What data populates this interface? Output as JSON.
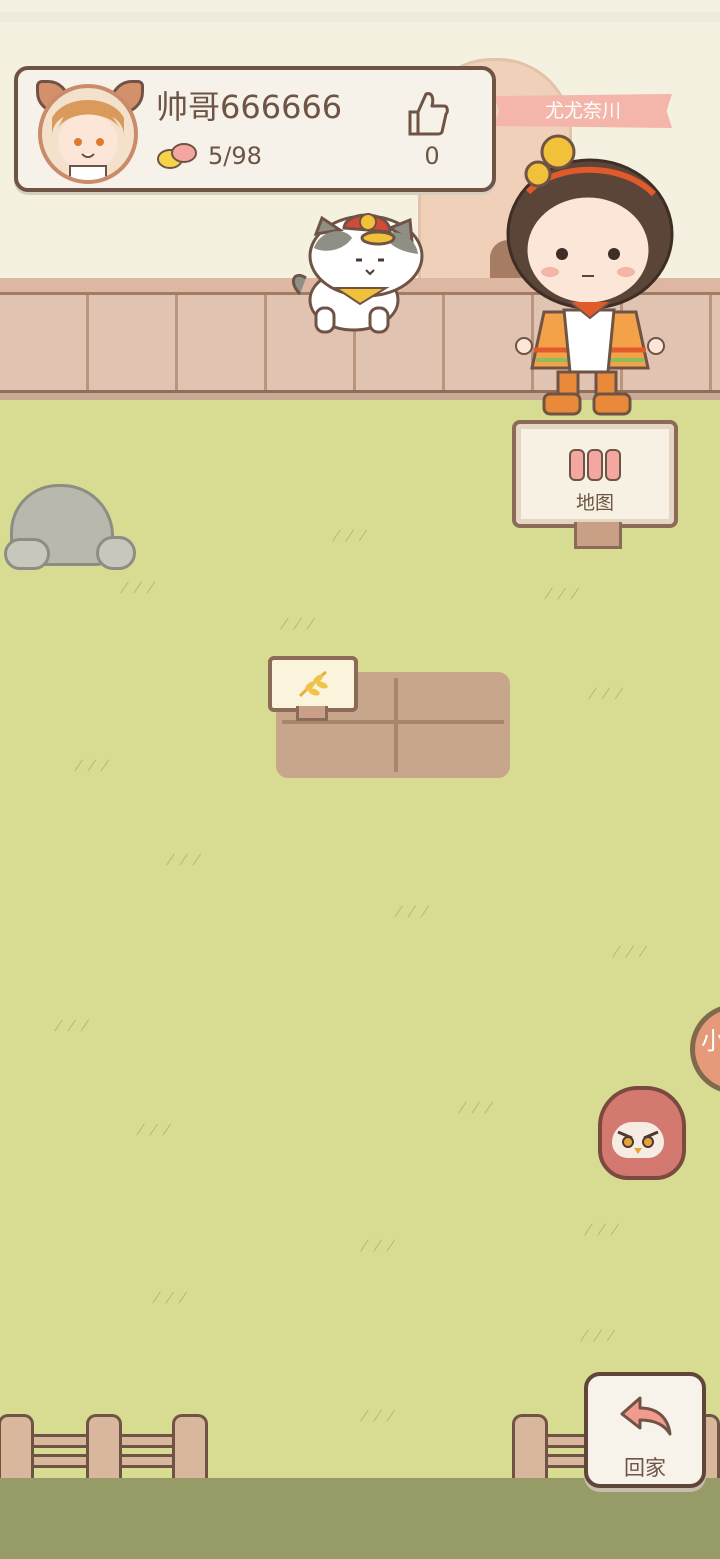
{
  "profile": {
    "username": "帅哥666666",
    "stat": "5/98",
    "likes": "0",
    "icons": {
      "stat": "pet-food-icon",
      "likes": "thumbs-up-icon"
    }
  },
  "owner_banner": {
    "name": "尤尤奈川"
  },
  "buttons": {
    "map_label": "地图",
    "home_label": "回家"
  },
  "side_badge": {
    "text": "小"
  },
  "colors": {
    "lawn": "#d8dc92",
    "sky": "#f5f1e1",
    "wall": "#e0c4b1",
    "banner": "#f4b6aa",
    "text": "#6f5445"
  }
}
